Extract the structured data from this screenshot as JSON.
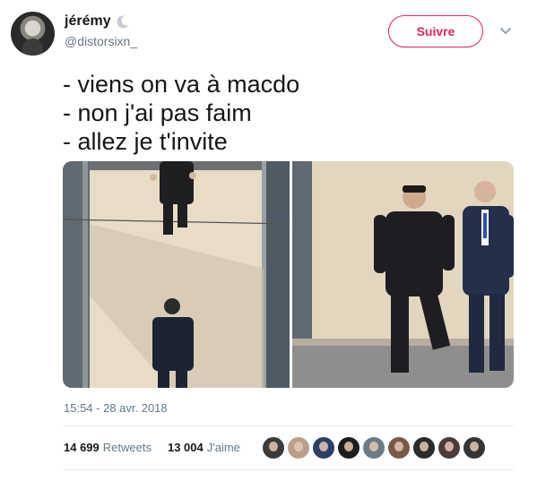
{
  "author": {
    "display_name": "jérémy",
    "handle": "@distorsixn_",
    "badge_icon": "crescent-moon-icon"
  },
  "actions": {
    "follow_label": "Suivre",
    "more_icon": "chevron-down-icon"
  },
  "tweet": {
    "lines": [
      "- viens on va à macdo",
      "- non j'ai pas faim",
      "- allez je t'invite"
    ],
    "timestamp": "15:54 - 28 avr. 2018"
  },
  "stats": {
    "retweets_count": "14 699",
    "retweets_label": "Retweets",
    "likes_count": "13 004",
    "likes_label": "J'aime"
  },
  "likers": [
    {
      "icon": "liker-avatar"
    },
    {
      "icon": "liker-avatar"
    },
    {
      "icon": "liker-avatar"
    },
    {
      "icon": "liker-avatar"
    },
    {
      "icon": "liker-avatar"
    },
    {
      "icon": "liker-avatar"
    },
    {
      "icon": "liker-avatar"
    },
    {
      "icon": "liker-avatar"
    },
    {
      "icon": "liker-avatar"
    }
  ],
  "colors": {
    "follow_accent": "#e0245e",
    "secondary_text": "#657786",
    "primary_text": "#14171a",
    "divider": "#e6ecf0"
  }
}
